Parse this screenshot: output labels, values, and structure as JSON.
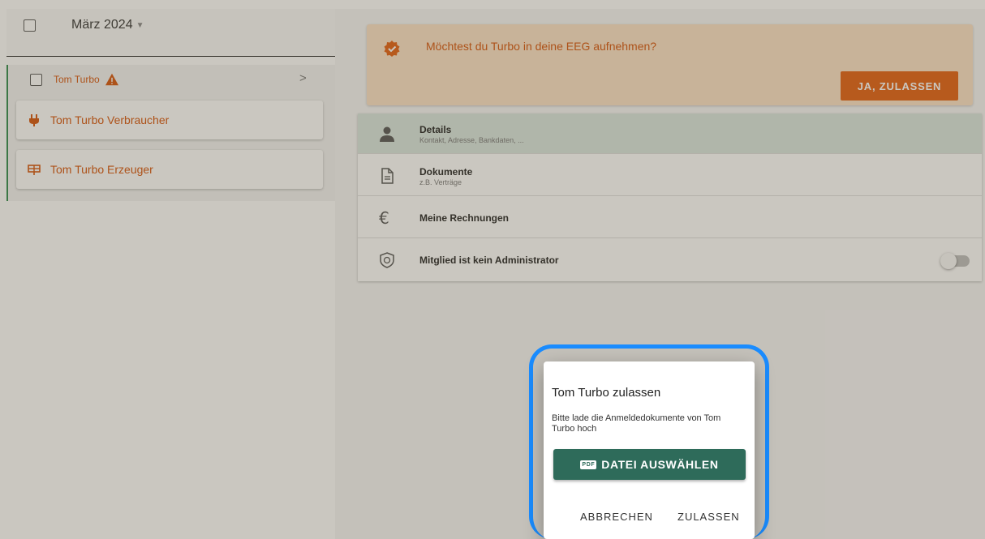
{
  "sidebar": {
    "month": "März 2024",
    "member": {
      "name": "Tom Turbo"
    },
    "cards": [
      {
        "label": "Tom Turbo Verbraucher",
        "icon": "plug-icon"
      },
      {
        "label": "Tom Turbo Erzeuger",
        "icon": "solar-panel-icon"
      }
    ]
  },
  "banner": {
    "text": "Möchtest du Turbo in deine EEG aufnehmen?",
    "button_label": "JA, ZULASSEN"
  },
  "menu": {
    "items": [
      {
        "title": "Details",
        "subtitle": "Kontakt, Adresse, Bankdaten, ...",
        "icon": "person-icon"
      },
      {
        "title": "Dokumente",
        "subtitle": "z.B. Verträge",
        "icon": "document-icon"
      },
      {
        "title": "Meine Rechnungen",
        "icon": "euro-icon"
      },
      {
        "title": "Mitglied ist kein Administrator",
        "icon": "shield-icon",
        "toggle_on": false
      }
    ]
  },
  "dialog": {
    "title": "Tom Turbo zulassen",
    "text": "Bitte lade die Anmeldedokumente von Tom Turbo hoch",
    "file_button": "DATEI AUSWÄHLEN",
    "pdf_badge": "PDF",
    "cancel": "ABBRECHEN",
    "confirm": "ZULASSEN"
  },
  "colors": {
    "accent": "#d5530a",
    "button_orange": "#e35f10",
    "primary_green": "#2e6b5a",
    "highlight_blue": "#1a8cff"
  }
}
